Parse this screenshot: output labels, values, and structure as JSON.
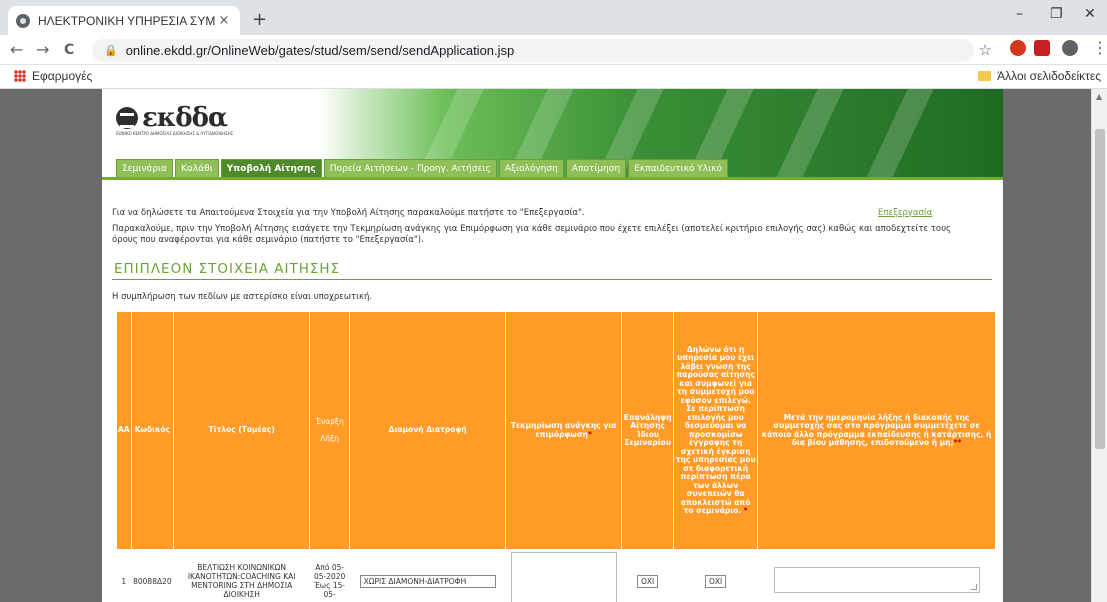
{
  "browser": {
    "tab_title": "ΗΛΕΚΤΡΟΝΙΚΗ ΥΠΗΡΕΣΙΑ ΣΥΜΜ",
    "tab_close": "×",
    "new_tab": "+",
    "url": "online.ekdd.gr/OnlineWeb/gates/stud/sem/send/sendApplication.jsp",
    "bookmarks_apps": "Εφαρμογές",
    "bookmarks_other": "Άλλοι σελιδοδείκτες",
    "window_minimize": "–",
    "window_maximize": "❐",
    "window_close": "✕",
    "back": "←",
    "forward": "→",
    "reload": "C",
    "lock": "🔒",
    "star": "☆",
    "menu": "⋮"
  },
  "site": {
    "logo_text": "εκδδα",
    "logo_subtitle": "ΕΘΝΙΚΟ ΚΕΝΤΡΟ ΔΗΜΟΣΙΑΣ ΔΙΟΙΚΗΣΗΣ & ΑΥΤΟΔΙΟΙΚΗΣΗΣ",
    "menu": [
      {
        "label": "Σεμινάρια"
      },
      {
        "label": "Καλάθι"
      },
      {
        "label": "Υποβολή Αίτησης"
      },
      {
        "label": "Πορεία Αιτήσεων - Προηγ. Αιτήσεις"
      },
      {
        "label": "Αξιολόγηση"
      },
      {
        "label": "Αποτίμηση"
      },
      {
        "label": "Εκπαιδευτικό Υλικό"
      }
    ],
    "active_menu": "Υποβολή Αίτησης"
  },
  "content": {
    "msg1": "Για να δηλώσετε τα Απαιτούμενα Στοιχεία για την Υποβολή Αίτησης παρακαλούμε πατήστε το \"Επεξεργασία\".",
    "edit_link": "Επεξεργασία",
    "msg2a": "Παρακαλούμε, πριν την Υποβολή Αίτησης εισάγετε την Τεκμηρίωση ανάγκης για Επιμόρφωση για κάθε σεμινάριο που έχετε επιλέξει (αποτελεί κριτήριο επιλογής σας) καθώς και αποδεχτείτε τους",
    "msg2b": "όρους που αναφέρονται για κάθε σεμινάριο (πατήστε το \"Επεξεργασία\").",
    "section_title": "ΕΠΙΠΛΕΟΝ ΣΤΟΙΧΕΙΑ ΑΙΤΗΣΗΣ",
    "required_note": "Η συμπλήρωση των πεδίων με αστερίσκο είναι υποχρεωτική."
  },
  "table": {
    "headers": {
      "aa": "ΑΑ",
      "code": "Κωδικός",
      "title": "Τίτλος (Τομέας)",
      "start": "Έναρξη",
      "end": "Λήξη",
      "accommodation": "Διαμονή Διατροφή",
      "justification": "Τεκμηρίωση ανάγκης για επιμόρφωση",
      "justification_star": "*",
      "repeat": "Επανάληψη Αίτησης Ίδιου Σεμιναρίου",
      "declaration": "Δηλώνω ότι η υπηρεσία μου έχει λάβει γνώση της παρούσας αίτησης και συμφωνεί για τη συμμετοχή μου εφόσον επιλεγώ. Σε περίπτωση επιλογής μου δεσμεύομαι να προσκομίσω έγγραφης τη σχετική έγκριση της υπηρεσίας μου σε διαφορετική περίπτωση πέρα των άλλων συνεπειών θα αποκλειστώ από το σεμινάριο.",
      "declaration_star": "*",
      "other_program": "Μετά την ημερομηνία λήξης ή διακοπής της συμμετοχής σας στο πρόγραμμα συμμετέχετε σε κάποιο άλλο πρόγραμμα εκπαίδευσης ή κατάρτισης, ή δια βίου μάθησης, επιδοτούμενο ή μη;",
      "other_star": "**"
    },
    "rows": [
      {
        "aa": "1",
        "code": "80088Δ20",
        "title": "ΒΕΛΤΙΩΣΗ ΚΟΙΝΩΝΙΚΩΝ ΙΚΑΝΟΤΗΤΩΝ:COACHING ΚΑΙ MENTORING ΣΤΗ ΔΗΜΟΣΙΑ ΔΙΟΙΚΗΣΗ",
        "dates": "Από 05-05-2020 Έως 15-05-",
        "accommodation": "ΧΩΡΙΣ ΔΙΑΜΟΝΗ-ΔΙΑΤΡΟΦΗ",
        "repeat": "ΟΧΙ",
        "declaration": "ΟΧΙ"
      }
    ]
  }
}
